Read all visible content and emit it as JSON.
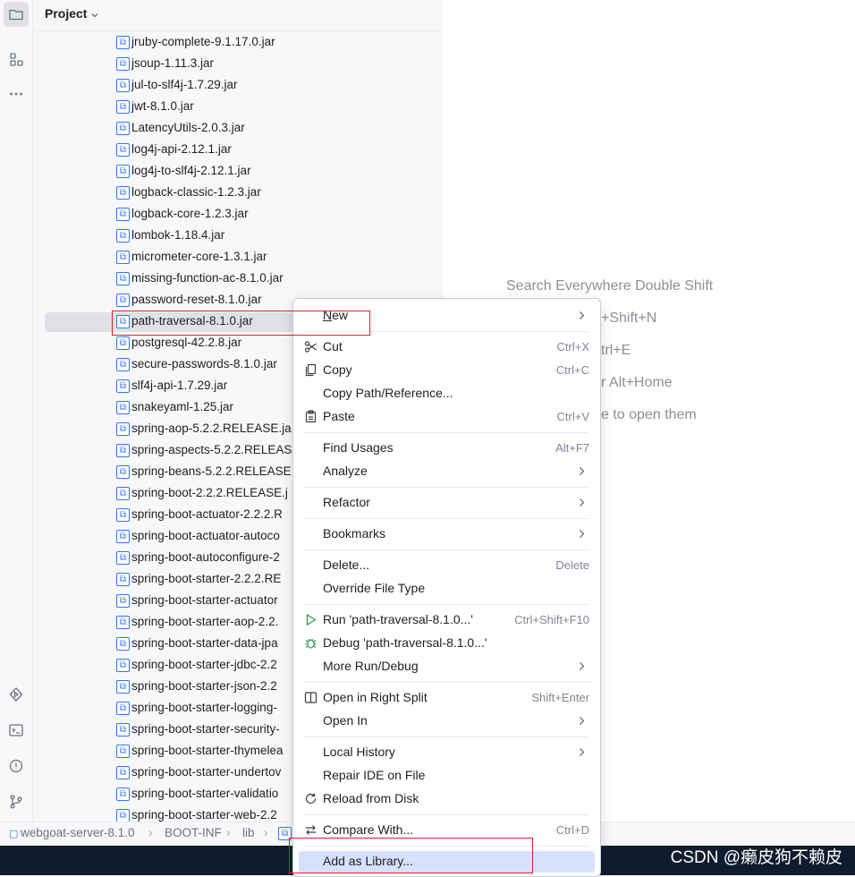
{
  "toolstrip": {
    "top_icons": [
      "folder-icon",
      "structure-icon",
      "more-icon"
    ],
    "bottom_icons": [
      "services-icon",
      "terminal-icon",
      "problems-icon",
      "git-icon"
    ]
  },
  "project_panel": {
    "title": "Project",
    "selected_file": "path-traversal-8.1.0.jar",
    "files": [
      "jruby-complete-9.1.17.0.jar",
      "jsoup-1.11.3.jar",
      "jul-to-slf4j-1.7.29.jar",
      "jwt-8.1.0.jar",
      "LatencyUtils-2.0.3.jar",
      "log4j-api-2.12.1.jar",
      "log4j-to-slf4j-2.12.1.jar",
      "logback-classic-1.2.3.jar",
      "logback-core-1.2.3.jar",
      "lombok-1.18.4.jar",
      "micrometer-core-1.3.1.jar",
      "missing-function-ac-8.1.0.jar",
      "password-reset-8.1.0.jar",
      "path-traversal-8.1.0.jar",
      "postgresql-42.2.8.jar",
      "secure-passwords-8.1.0.jar",
      "slf4j-api-1.7.29.jar",
      "snakeyaml-1.25.jar",
      "spring-aop-5.2.2.RELEASE.ja",
      "spring-aspects-5.2.2.RELEAS",
      "spring-beans-5.2.2.RELEASE",
      "spring-boot-2.2.2.RELEASE.j",
      "spring-boot-actuator-2.2.2.R",
      "spring-boot-actuator-autoco",
      "spring-boot-autoconfigure-2",
      "spring-boot-starter-2.2.2.RE",
      "spring-boot-starter-actuator",
      "spring-boot-starter-aop-2.2.",
      "spring-boot-starter-data-jpa",
      "spring-boot-starter-jdbc-2.2",
      "spring-boot-starter-json-2.2",
      "spring-boot-starter-logging-",
      "spring-boot-starter-security-",
      "spring-boot-starter-thymelea",
      "spring-boot-starter-undertov",
      "spring-boot-starter-validatio",
      "spring-boot-starter-web-2.2"
    ]
  },
  "editor_hints": [
    "Search Everywhere Double Shift",
    "+Shift+N",
    "trl+E",
    "r Alt+Home",
    "e to open them"
  ],
  "breadcrumb": {
    "items": [
      "webgoat-server-8.1.0",
      "BOOT-INF",
      "lib"
    ],
    "separator": "›"
  },
  "watermark": "CSDN @癞皮狗不赖皮",
  "context_menu": {
    "new": {
      "label": "New",
      "mnemonic": "N",
      "rest": "ew",
      "icon": "chevron-right-icon"
    },
    "cut": {
      "label": "Cut",
      "shortcut": "Ctrl+X",
      "icon": "scissors-icon"
    },
    "copy": {
      "label": "Copy",
      "shortcut": "Ctrl+C",
      "icon": "copy-icon"
    },
    "copy_path": {
      "label": "Copy Path/Reference..."
    },
    "paste": {
      "label": "Paste",
      "shortcut": "Ctrl+V",
      "icon": "paste-icon"
    },
    "find_usages": {
      "label": "Find Usages",
      "shortcut": "Alt+F7"
    },
    "analyze": {
      "label": "Analyze",
      "icon": "chevron-right-icon"
    },
    "refactor": {
      "label": "Refactor",
      "icon": "chevron-right-icon"
    },
    "bookmarks": {
      "label": "Bookmarks",
      "icon": "chevron-right-icon"
    },
    "delete": {
      "label": "Delete...",
      "shortcut": "Delete"
    },
    "override_file_type": {
      "label": "Override File Type"
    },
    "run": {
      "label": "Run 'path-traversal-8.1.0...'",
      "shortcut": "Ctrl+Shift+F10",
      "icon": "run-icon",
      "color": "#369650"
    },
    "debug": {
      "label": "Debug 'path-traversal-8.1.0...'",
      "icon": "debug-icon",
      "color": "#369650"
    },
    "more_run_debug": {
      "label": "More Run/Debug",
      "icon": "chevron-right-icon"
    },
    "open_right_split": {
      "label": "Open in Right Split",
      "shortcut": "Shift+Enter",
      "icon": "split-icon"
    },
    "open_in": {
      "label": "Open In",
      "icon": "chevron-right-icon"
    },
    "local_history": {
      "label": "Local History",
      "icon": "chevron-right-icon"
    },
    "repair_ide": {
      "label": "Repair IDE on File"
    },
    "reload": {
      "label": "Reload from Disk",
      "icon": "reload-icon"
    },
    "compare_with": {
      "label": "Compare With...",
      "shortcut": "Ctrl+D",
      "icon": "compare-icon"
    },
    "add_as_library": {
      "label": "Add as Library..."
    }
  },
  "colors": {
    "highlight_box": "#e0202a",
    "menu_selection": "#d5e1fd",
    "jar_icon": "#3574f0"
  }
}
